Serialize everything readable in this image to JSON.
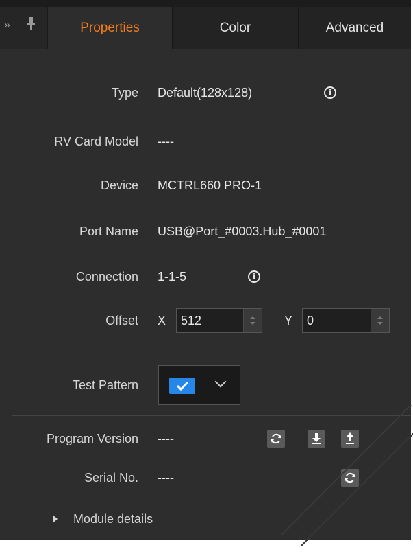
{
  "tabs": {
    "properties": "Properties",
    "color": "Color",
    "advanced": "Advanced"
  },
  "tab_controls": {
    "expand_glyph": "»",
    "pin_glyph": "⊥"
  },
  "fields": {
    "type": {
      "label": "Type",
      "value": "Default(128x128)"
    },
    "rv_card_model": {
      "label": "RV Card Model",
      "value": "----"
    },
    "device": {
      "label": "Device",
      "value": "MCTRL660 PRO-1"
    },
    "port_name": {
      "label": "Port Name",
      "value": "USB@Port_#0003.Hub_#0001"
    },
    "connection": {
      "label": "Connection",
      "value": "1-1-5"
    },
    "offset": {
      "label": "Offset",
      "x_label": "X",
      "x_value": "512",
      "y_label": "Y",
      "y_value": "0"
    },
    "test_pattern": {
      "label": "Test Pattern",
      "checked": true
    },
    "program_version": {
      "label": "Program Version",
      "value": "----"
    },
    "serial_no": {
      "label": "Serial No.",
      "value": "----"
    }
  },
  "info_glyph": "i",
  "module_details": {
    "label": "Module details"
  },
  "colors": {
    "background": "#2d2d2d",
    "active_tab_text": "#f07c1a",
    "checkbox_blue": "#2787e8"
  },
  "icons": [
    "expand-icon",
    "pin-icon",
    "info-icon",
    "checkmark-icon",
    "chevron-down-icon",
    "refresh-icon",
    "download-icon",
    "upload-icon",
    "triangle-right-icon"
  ]
}
